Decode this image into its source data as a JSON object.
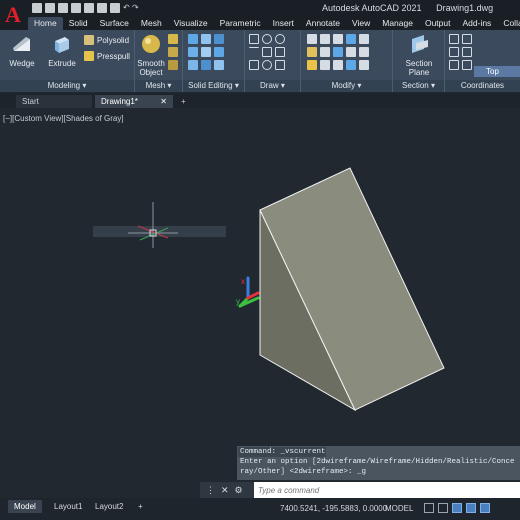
{
  "app": {
    "title": "Autodesk AutoCAD 2021",
    "file": "Drawing1.dwg"
  },
  "ribbon_tabs": [
    "Home",
    "Solid",
    "Surface",
    "Mesh",
    "Visualize",
    "Parametric",
    "Insert",
    "Annotate",
    "View",
    "Manage",
    "Output",
    "Add-ins",
    "Collaborate"
  ],
  "ribbon": {
    "panels": {
      "modeling": "Modeling",
      "mesh": "Mesh",
      "solid_editing": "Solid Editing",
      "draw": "Draw",
      "modify": "Modify",
      "section": "Section",
      "coordinates": "Coordinates"
    },
    "buttons": {
      "wedge": "Wedge",
      "extrude": "Extrude",
      "polysolid": "Polysolid",
      "presspull": "Presspull",
      "smooth": "Smooth",
      "object": "Object",
      "section_plane_1": "Section",
      "section_plane_2": "Plane"
    },
    "view_dropdown": "Top"
  },
  "document_tabs": {
    "start": "Start",
    "drawing": "Drawing1*",
    "close": "✕",
    "add": "+"
  },
  "viewport": {
    "label": "[−][Custom View][Shades of Gray]"
  },
  "command": {
    "history_1": "Command: _vscurrent",
    "history_2": "Enter an option [2dwireframe/Wireframe/Hidden/Realistic/Conce",
    "history_3": "ray/Other] <2dwireframe>: _g",
    "placeholder": "Type a command",
    "close": "✕",
    "wrench": "🔧"
  },
  "statusbar": {
    "layouts": [
      "Model",
      "Layout1",
      "Layout2"
    ],
    "add": "+",
    "coordinates": "7400.5241, -195.5883, 0.0000",
    "space": "MODEL"
  },
  "colors": {
    "viewport_bg": "#212830",
    "ribbon_bg": "#3b4a5c",
    "wedge_face_front": "#8b8d7e",
    "wedge_face_side": "#6a6c60",
    "axis_x": "#e8303a",
    "axis_y": "#3fbf3f",
    "axis_z": "#3a7fe0"
  }
}
